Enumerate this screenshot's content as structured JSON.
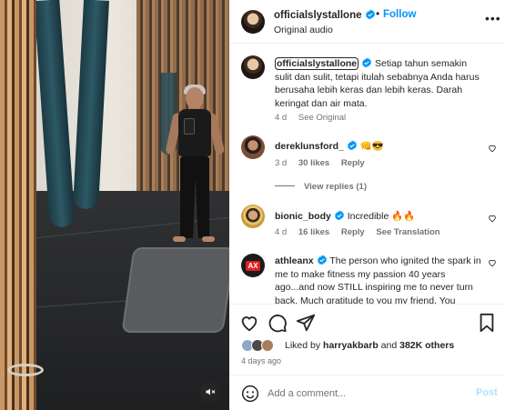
{
  "colors": {
    "accent": "#0095f6",
    "muted": "#737373",
    "text": "#262626",
    "like_red": "#ff3040"
  },
  "media": {
    "mute_icon": "speaker-muted-icon"
  },
  "header": {
    "username": "officialslystallone",
    "follow_label": "Follow",
    "dot": "•",
    "subtitle": "Original audio",
    "more_icon": "more-horizontal-icon"
  },
  "caption": {
    "username": "officialslystallone",
    "text": "Setiap tahun semakin sulit dan sulit, tetapi itulah sebabnya Anda harus berusaha lebih keras dan lebih keras. Darah keringat dan air mata.",
    "time": "4 d",
    "see_original": "See Original"
  },
  "comments": [
    {
      "username": "dereklunsford_",
      "text": "👊😎",
      "time": "3 d",
      "likes": "30 likes",
      "reply": "Reply",
      "view_replies": "View replies (1)"
    },
    {
      "username": "bionic_body",
      "text": "Incredible 🔥🔥",
      "time": "4 d",
      "likes": "16 likes",
      "reply": "Reply",
      "see_translation": "See Translation"
    },
    {
      "username": "athleanx",
      "avatar_text": "AX",
      "text": "The person who ignited the spark in me to make fitness my passion 40 years ago...and now STILL inspiring me to never turn back. Much gratitude to you my friend. You"
    }
  ],
  "likes": {
    "prefix": "Liked by",
    "user": "harryakbarb",
    "and": "and",
    "count": "382K others"
  },
  "time_ago": "4 days ago",
  "add_comment": {
    "placeholder": "Add a comment...",
    "post_label": "Post"
  }
}
